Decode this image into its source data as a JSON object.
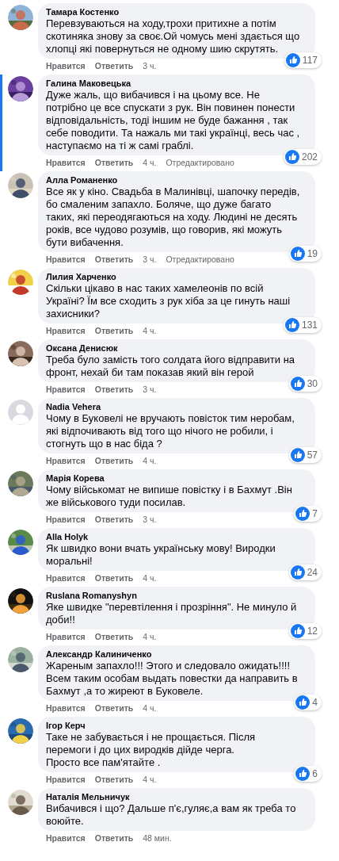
{
  "comments": [
    {
      "author": "Тамара Костенко",
      "kind": "picture",
      "highlighted": false,
      "text": "Перевзуваються на ходу,трохи притихне а потім скотиняка знову за своє.Ой чомусь мені здається що хлопці які повернуться не одному шию скрутять.",
      "reactions": "117",
      "like": "Нравится",
      "reply": "Ответить",
      "time": "3 ч."
    },
    {
      "author": "Галина Маковецька",
      "kind": "picture",
      "highlighted": true,
      "text": "Дуже жаль, що вибачився і на цьому все. Не потрібно це все спускати з рук. Він повинен понести відповідальність, тоді іншим не буде бажання , так себе поводити. Та нажаль ми такі українці, весь час , наступаємо на ті ж самі граблі.",
      "reactions": "202",
      "like": "Нравится",
      "reply": "Ответить",
      "time": "4 ч.",
      "edited": "Отредактировано"
    },
    {
      "author": "Алла Романенко",
      "kind": "picture",
      "highlighted": false,
      "text": "Все як у кіно. Свадьба в Малинівці, шапочку передів, бо смаленим запахло. Боляче, що дуже багато таких, які переодягаються на ходу. Людині не десять років, все чудово розумів, що говорив, які можуть бути вибачення.",
      "reactions": "19",
      "like": "Нравится",
      "reply": "Ответить",
      "time": "3 ч.",
      "edited": "Отредактировано"
    },
    {
      "author": "Лилия Харченко",
      "kind": "picture",
      "highlighted": false,
      "text": "Скільки цікаво в нас таких хамелеонів по всій Україні? Їм все сходить з рук хіба за це гинуть наші захисники?",
      "reactions": "131",
      "like": "Нравится",
      "reply": "Ответить",
      "time": "4 ч."
    },
    {
      "author": "Оксана Денисюк",
      "kind": "picture",
      "highlighted": false,
      "text": "Треба було замість того солдата його відправити на фронт, нехай би там показав який він герой",
      "reactions": "30",
      "like": "Нравится",
      "reply": "Ответить",
      "time": "3 ч."
    },
    {
      "author": "Nadia Vehera",
      "kind": "default",
      "highlighted": false,
      "text": "Чому в Буковелі не вручають повісток тим неробам, які відпочивають від того що нічого не робили, і стогнуть що в нас біда ?",
      "reactions": "57",
      "like": "Нравится",
      "reply": "Ответить",
      "time": "4 ч."
    },
    {
      "author": "Марія Корева",
      "kind": "picture",
      "highlighted": false,
      "text": "Чому військомат не випише повістку і в Бахмут .Він же військового туди посилав.",
      "reactions": "7",
      "like": "Нравится",
      "reply": "Ответить",
      "time": "3 ч."
    },
    {
      "author": "Alla Holyk",
      "kind": "picture",
      "highlighted": false,
      "text": "Як швидко вони вчать українську мову! Виродки моральні!",
      "reactions": "24",
      "like": "Нравится",
      "reply": "Ответить",
      "time": "4 ч."
    },
    {
      "author": "Ruslana Romanyshyn",
      "kind": "picture",
      "highlighted": false,
      "text": "Яке швидке \"перевтілення і прозріння\". Не минуло й доби!!",
      "reactions": "12",
      "like": "Нравится",
      "reply": "Ответить",
      "time": "4 ч."
    },
    {
      "author": "Александр Калиниченко",
      "kind": "picture",
      "highlighted": false,
      "text": "Жареным запахло!!! Этого и следовало ожидать!!!! Всем таким особам выдать повестки да направить в Бахмут ,а то жиреют в Буковеле.",
      "reactions": "4",
      "like": "Нравится",
      "reply": "Ответить",
      "time": "4 ч."
    },
    {
      "author": "Ігор Керч",
      "kind": "picture",
      "highlighted": false,
      "text": "Таке не забувається і не прощається. Після перемоги і до цих виродків дійде черга.\nПросто все пам'ятайте .",
      "reactions": "6",
      "like": "Нравится",
      "reply": "Ответить",
      "time": "4 ч."
    },
    {
      "author": "Наталія Мельничук",
      "kind": "picture",
      "highlighted": false,
      "text": "Вибачився і що? Дальше п'є,гуляє,а вам як треба то воюйте.",
      "like": "Нравится",
      "reply": "Ответить",
      "time": "48 мин."
    }
  ]
}
